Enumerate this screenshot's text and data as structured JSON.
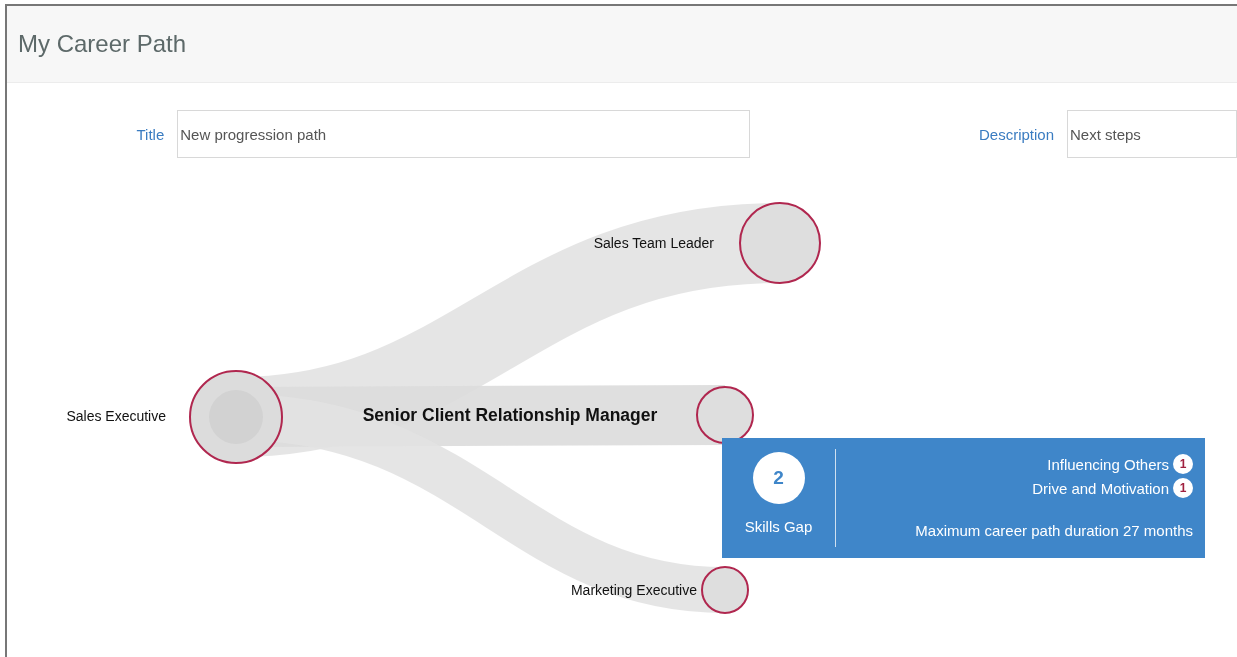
{
  "header": {
    "title": "My Career Path"
  },
  "form": {
    "fields": [
      {
        "label": "Title",
        "value": "New progression path"
      },
      {
        "label": "Description",
        "value": "Next steps"
      }
    ]
  },
  "path": {
    "origin": "Sales Executive",
    "targets": [
      {
        "label": "Sales Team Leader",
        "selected": false
      },
      {
        "label": "Senior Client Relationship Manager",
        "selected": true
      },
      {
        "label": "Marketing Executive",
        "selected": false
      }
    ]
  },
  "skills_gap": {
    "count": "2",
    "label": "Skills Gap",
    "skills": [
      {
        "name": "Influencing Others",
        "count": "1"
      },
      {
        "name": "Drive and Motivation",
        "count": "1"
      }
    ],
    "duration": "Maximum career path duration 27 months"
  }
}
